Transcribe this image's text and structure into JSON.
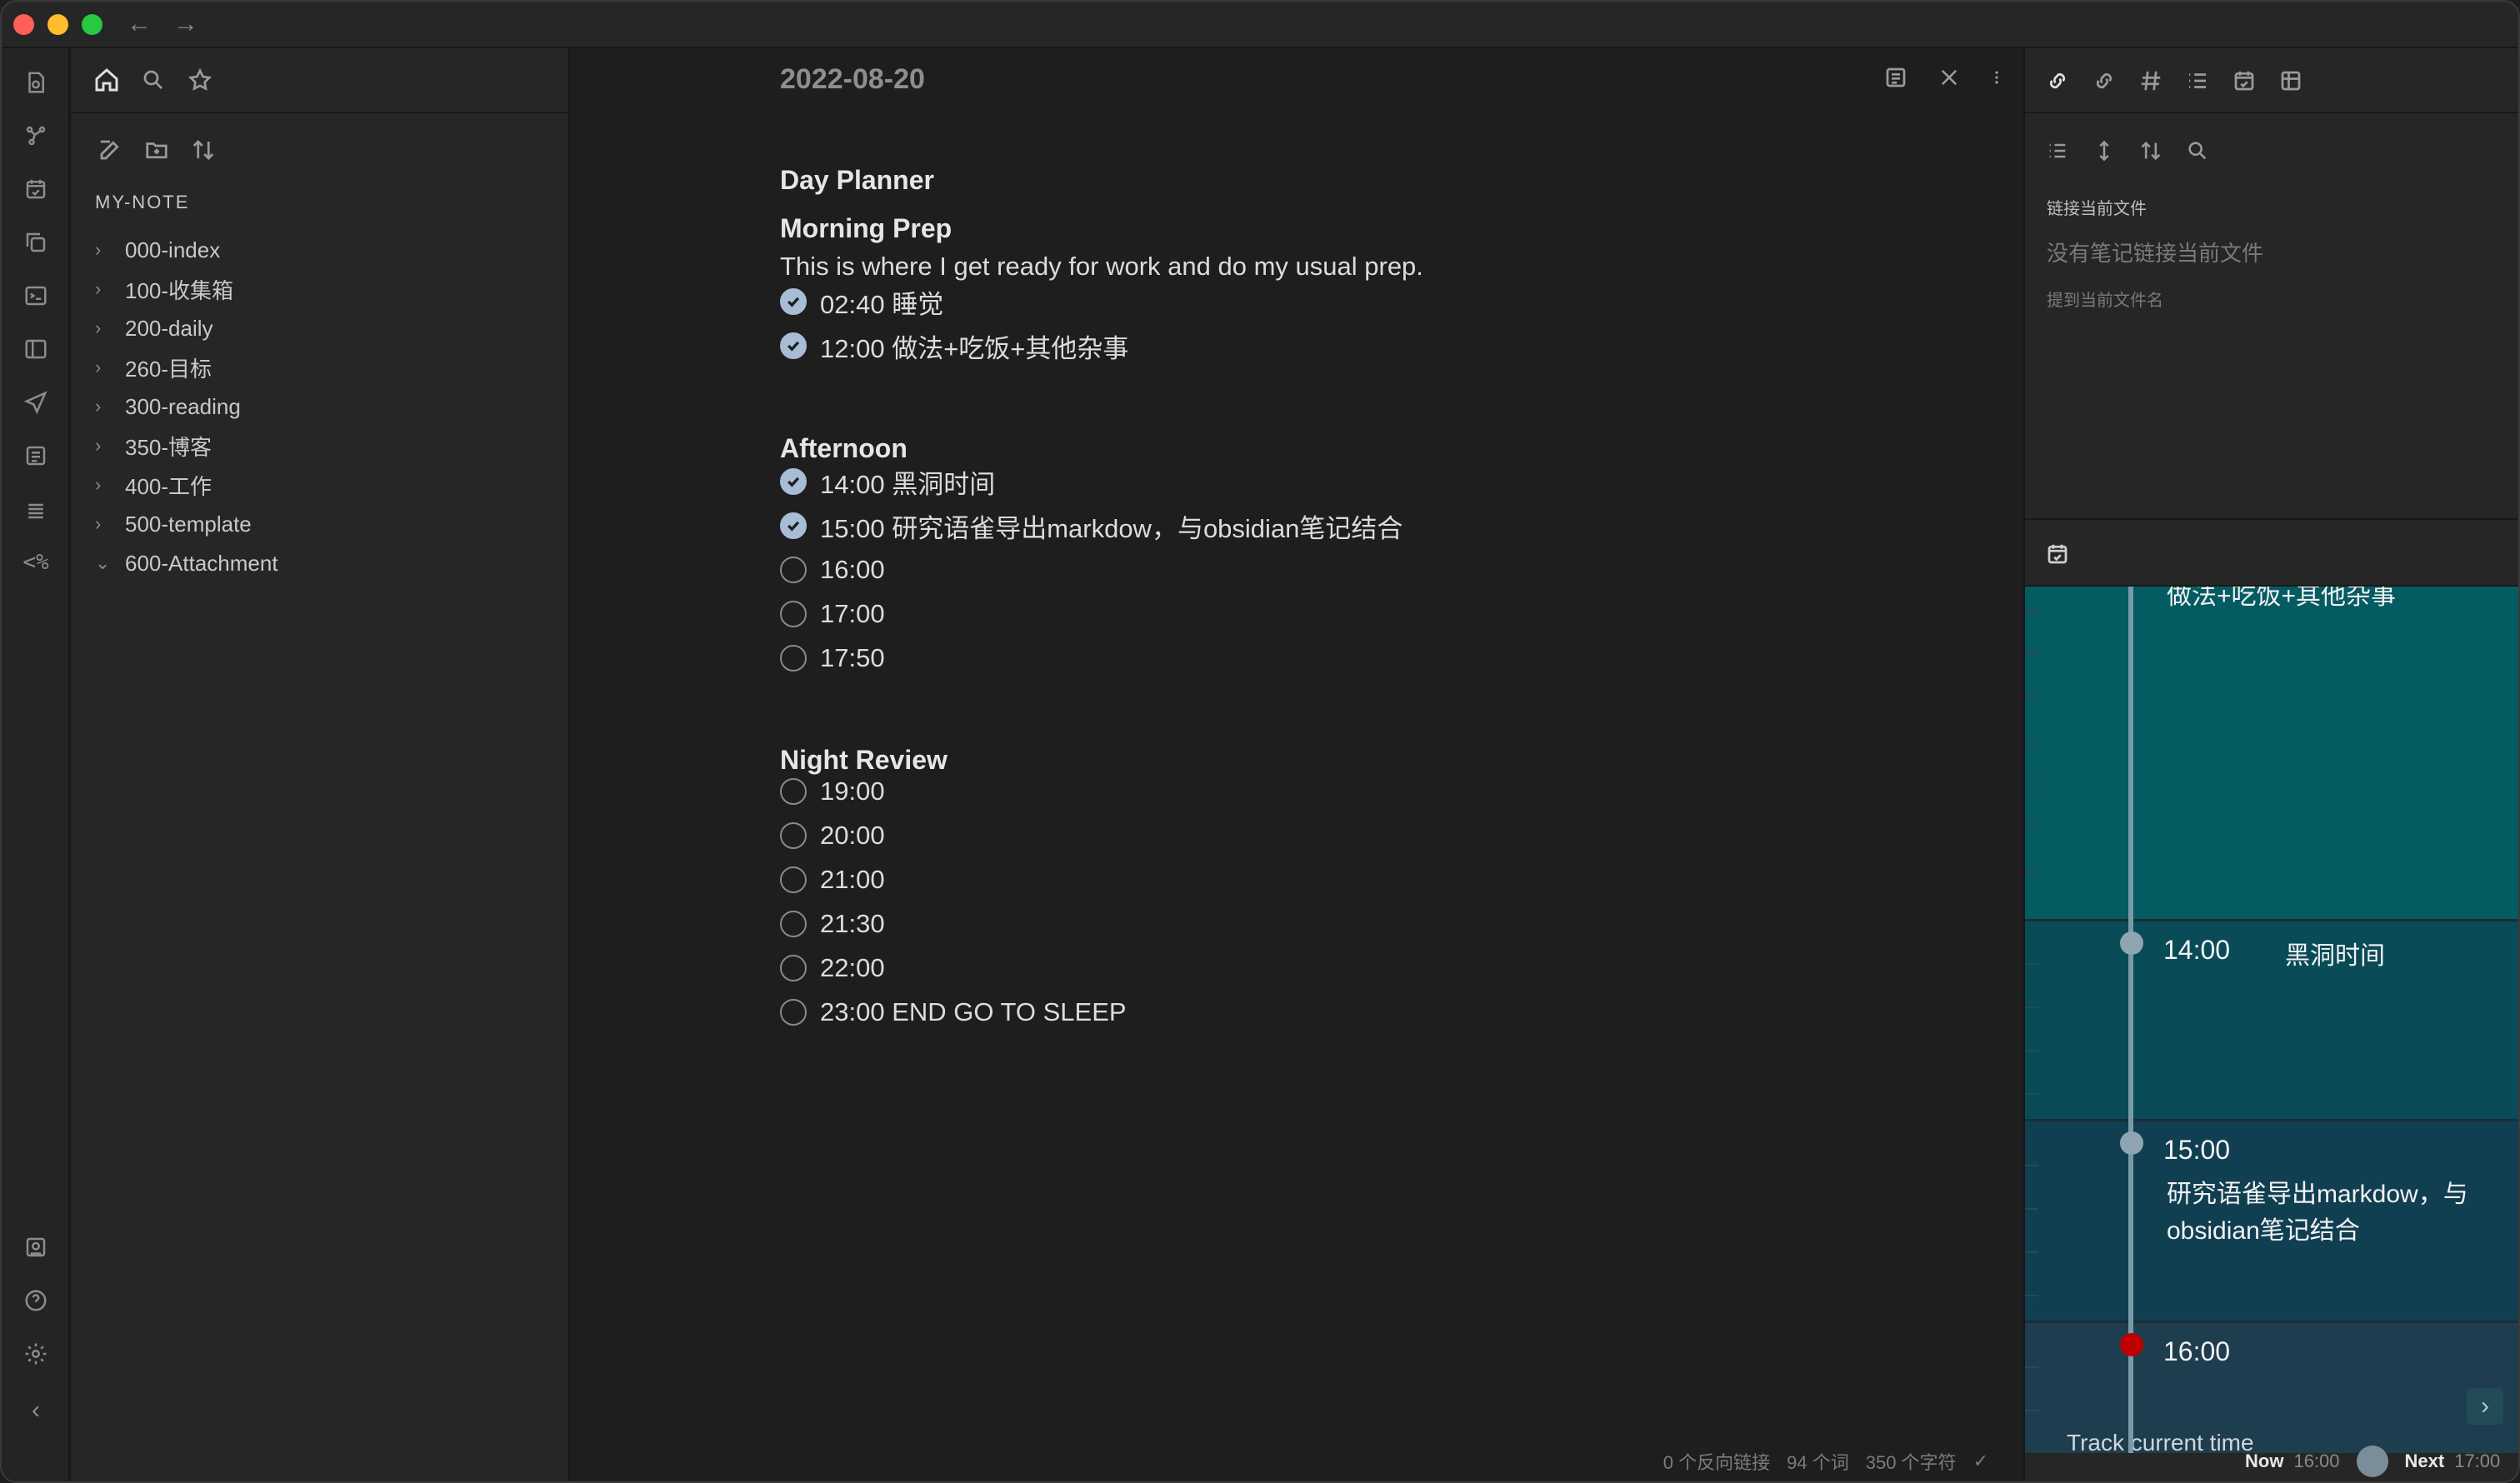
{
  "window": {
    "traffic_lights": [
      "close",
      "minimize",
      "zoom"
    ],
    "colors": {
      "close": "#ff5f57",
      "minimize": "#febc2e",
      "zoom": "#28c840",
      "accent": "#a8bcd6",
      "planner_teal": "#055b62",
      "planner_blue": "#1e3d4f",
      "now_dot": "#c00000"
    }
  },
  "sidebar": {
    "vault_name": "MY-NOTE",
    "items": [
      {
        "label": "000-index",
        "expanded": false
      },
      {
        "label": "100-收集箱",
        "expanded": false
      },
      {
        "label": "200-daily",
        "expanded": false
      },
      {
        "label": "260-目标",
        "expanded": false
      },
      {
        "label": "300-reading",
        "expanded": false
      },
      {
        "label": "350-博客",
        "expanded": false
      },
      {
        "label": "400-工作",
        "expanded": false
      },
      {
        "label": "500-template",
        "expanded": false
      },
      {
        "label": "600-Attachment",
        "expanded": true
      }
    ]
  },
  "editor": {
    "title": "2022-08-20",
    "heading": "Day Planner",
    "sections": {
      "morning": {
        "title": "Morning Prep",
        "desc": "This is where I get ready for work and do my usual prep.",
        "tasks": [
          {
            "text": "02:40 睡觉",
            "done": true
          },
          {
            "text": "12:00 做法+吃饭+其他杂事",
            "done": true
          }
        ]
      },
      "afternoon": {
        "title": "Afternoon",
        "tasks": [
          {
            "text": "14:00 黑洞时间",
            "done": true
          },
          {
            "text": "15:00 研究语雀导出markdow，与obsidian笔记结合",
            "done": true
          },
          {
            "text": "16:00",
            "done": false
          },
          {
            "text": "17:00",
            "done": false
          },
          {
            "text": "17:50",
            "done": false
          }
        ]
      },
      "night": {
        "title": "Night Review",
        "tasks": [
          {
            "text": "19:00",
            "done": false
          },
          {
            "text": "20:00",
            "done": false
          },
          {
            "text": "21:00",
            "done": false
          },
          {
            "text": "21:30",
            "done": false
          },
          {
            "text": "22:00",
            "done": false
          },
          {
            "text": "23:00 END GO TO SLEEP",
            "done": false
          }
        ]
      }
    }
  },
  "status": {
    "backlinks": "0 个反向链接",
    "words": "94 个词",
    "chars": "350 个字符"
  },
  "right_panel": {
    "linked_label": "链接当前文件",
    "linked_empty": "没有笔记链接当前文件",
    "mention_label": "提到当前文件名",
    "planner": {
      "block1_text": "做法+吃饭+其他杂事",
      "block2_time": "14:00",
      "block2_text": "黑洞时间",
      "block3_time": "15:00",
      "block3_text_a": "研究语雀导出markdow，与",
      "block3_text_b": "obsidian笔记结合",
      "block4_time": "16:00",
      "cutoff_text": "Track current time"
    },
    "now_label": "Now",
    "now_time": "16:00",
    "next_label": "Next",
    "next_time": "17:00"
  }
}
